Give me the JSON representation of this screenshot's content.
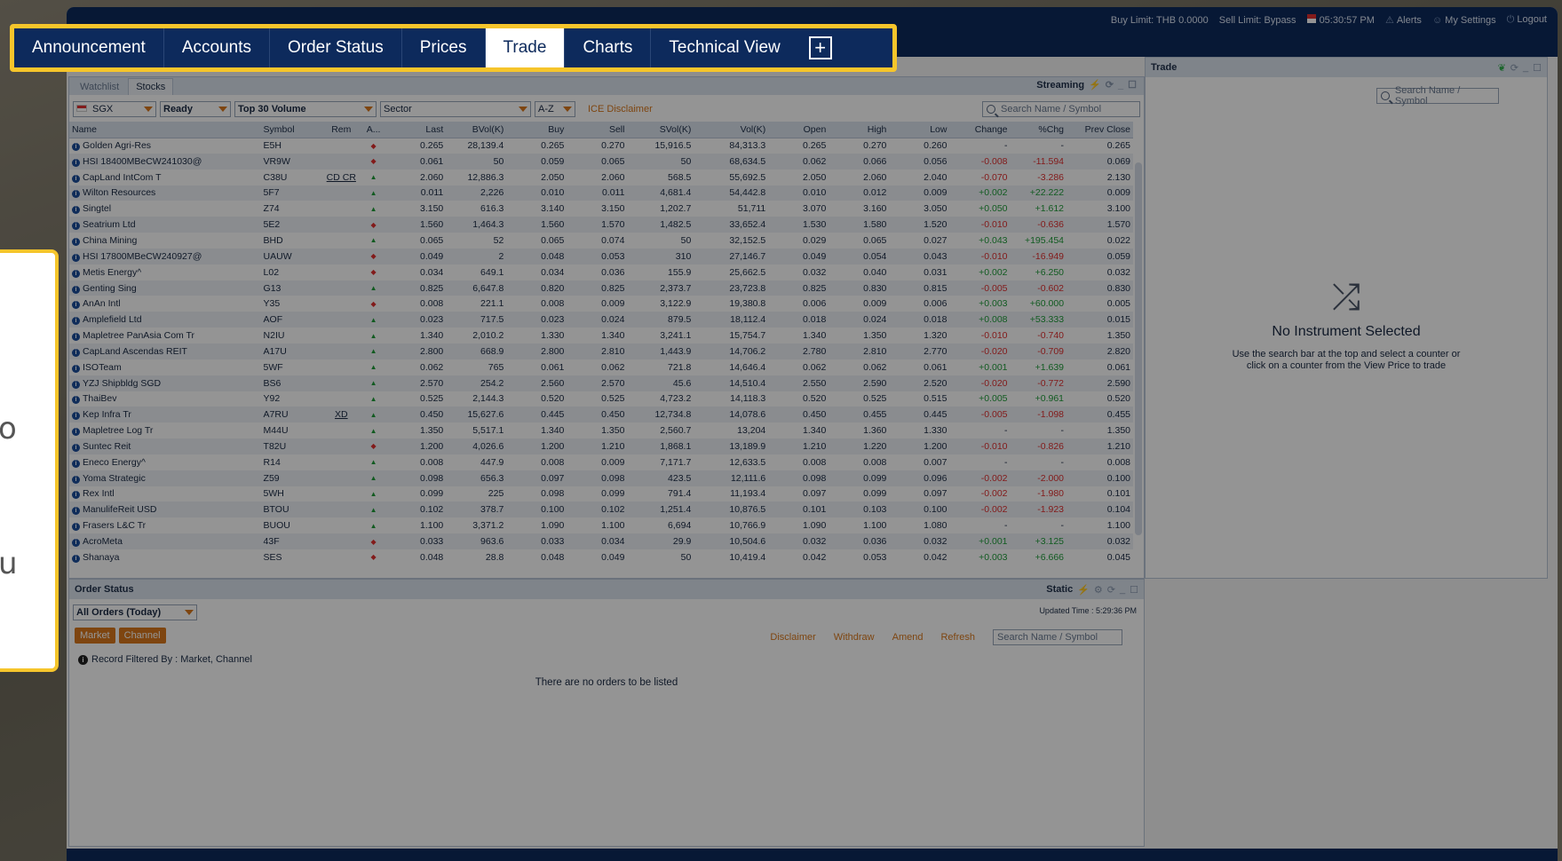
{
  "topbar": {
    "buy_limit": "Buy Limit: THB 0.0000",
    "sell_limit": "Sell Limit: Bypass",
    "time": "05:30:57 PM",
    "alerts": "Alerts",
    "settings": "My Settings",
    "logout": "Logout"
  },
  "nav": {
    "items": [
      "Announcement",
      "Accounts",
      "Order Status",
      "Prices",
      "Trade",
      "Charts",
      "Technical View"
    ],
    "active": "Trade"
  },
  "watchlist": {
    "tabs": [
      "Watchlist",
      "Stocks"
    ],
    "active_tab": "Stocks",
    "mode": "Streaming",
    "filters": {
      "market": "SGX",
      "status": "Ready",
      "list": "Top 30 Volume",
      "sector": "Sector",
      "sort": "A-Z",
      "disclaimer": "ICE Disclaimer",
      "search_placeholder": "Search Name / Symbol"
    },
    "columns": [
      "Name",
      "Symbol",
      "Rem",
      "A...",
      "Last",
      "BVol(K)",
      "Buy",
      "Sell",
      "SVol(K)",
      "Vol(K)",
      "Open",
      "High",
      "Low",
      "Change",
      "%Chg",
      "Prev Close"
    ],
    "rows": [
      {
        "name": "Golden Agri-Res",
        "symbol": "E5H",
        "rem": "",
        "dir": "dn",
        "last": "0.265",
        "bvol": "28,139.4",
        "buy": "0.265",
        "sell": "0.270",
        "svol": "15,916.5",
        "vol": "84,313.3",
        "open": "0.265",
        "high": "0.270",
        "low": "0.260",
        "chg": "-",
        "pchg": "-",
        "prev": "0.265"
      },
      {
        "name": "HSI 18400MBeCW241030@",
        "symbol": "VR9W",
        "rem": "",
        "dir": "dn",
        "last": "0.061",
        "bvol": "50",
        "buy": "0.059",
        "sell": "0.065",
        "svol": "50",
        "vol": "68,634.5",
        "open": "0.062",
        "high": "0.066",
        "low": "0.056",
        "chg": "-0.008",
        "pchg": "-11.594",
        "prev": "0.069"
      },
      {
        "name": "CapLand IntCom T",
        "symbol": "C38U",
        "rem": "CD CR",
        "dir": "up",
        "last": "2.060",
        "bvol": "12,886.3",
        "buy": "2.050",
        "sell": "2.060",
        "svol": "568.5",
        "vol": "55,692.5",
        "open": "2.050",
        "high": "2.060",
        "low": "2.040",
        "chg": "-0.070",
        "pchg": "-3.286",
        "prev": "2.130"
      },
      {
        "name": "Wilton Resources",
        "symbol": "5F7",
        "rem": "",
        "dir": "up",
        "last": "0.011",
        "bvol": "2,226",
        "buy": "0.010",
        "sell": "0.011",
        "svol": "4,681.4",
        "vol": "54,442.8",
        "open": "0.010",
        "high": "0.012",
        "low": "0.009",
        "chg": "+0.002",
        "pchg": "+22.222",
        "prev": "0.009"
      },
      {
        "name": "Singtel",
        "symbol": "Z74",
        "rem": "",
        "dir": "up",
        "last": "3.150",
        "bvol": "616.3",
        "buy": "3.140",
        "sell": "3.150",
        "svol": "1,202.7",
        "vol": "51,711",
        "open": "3.070",
        "high": "3.160",
        "low": "3.050",
        "chg": "+0.050",
        "pchg": "+1.612",
        "prev": "3.100"
      },
      {
        "name": "Seatrium Ltd",
        "symbol": "5E2",
        "rem": "",
        "dir": "dn",
        "last": "1.560",
        "bvol": "1,464.3",
        "buy": "1.560",
        "sell": "1.570",
        "svol": "1,482.5",
        "vol": "33,652.4",
        "open": "1.530",
        "high": "1.580",
        "low": "1.520",
        "chg": "-0.010",
        "pchg": "-0.636",
        "prev": "1.570"
      },
      {
        "name": "China Mining",
        "symbol": "BHD",
        "rem": "",
        "dir": "up",
        "last": "0.065",
        "bvol": "52",
        "buy": "0.065",
        "sell": "0.074",
        "svol": "50",
        "vol": "32,152.5",
        "open": "0.029",
        "high": "0.065",
        "low": "0.027",
        "chg": "+0.043",
        "pchg": "+195.454",
        "prev": "0.022"
      },
      {
        "name": "HSI 17800MBeCW240927@",
        "symbol": "UAUW",
        "rem": "",
        "dir": "dn",
        "last": "0.049",
        "bvol": "2",
        "buy": "0.048",
        "sell": "0.053",
        "svol": "310",
        "vol": "27,146.7",
        "open": "0.049",
        "high": "0.054",
        "low": "0.043",
        "chg": "-0.010",
        "pchg": "-16.949",
        "prev": "0.059"
      },
      {
        "name": "Metis Energy^",
        "symbol": "L02",
        "rem": "",
        "dir": "dn",
        "last": "0.034",
        "bvol": "649.1",
        "buy": "0.034",
        "sell": "0.036",
        "svol": "155.9",
        "vol": "25,662.5",
        "open": "0.032",
        "high": "0.040",
        "low": "0.031",
        "chg": "+0.002",
        "pchg": "+6.250",
        "prev": "0.032"
      },
      {
        "name": "Genting Sing",
        "symbol": "G13",
        "rem": "",
        "dir": "up",
        "last": "0.825",
        "bvol": "6,647.8",
        "buy": "0.820",
        "sell": "0.825",
        "svol": "2,373.7",
        "vol": "23,723.8",
        "open": "0.825",
        "high": "0.830",
        "low": "0.815",
        "chg": "-0.005",
        "pchg": "-0.602",
        "prev": "0.830"
      },
      {
        "name": "AnAn Intl",
        "symbol": "Y35",
        "rem": "",
        "dir": "dn",
        "last": "0.008",
        "bvol": "221.1",
        "buy": "0.008",
        "sell": "0.009",
        "svol": "3,122.9",
        "vol": "19,380.8",
        "open": "0.006",
        "high": "0.009",
        "low": "0.006",
        "chg": "+0.003",
        "pchg": "+60.000",
        "prev": "0.005"
      },
      {
        "name": "Amplefield Ltd",
        "symbol": "AOF",
        "rem": "",
        "dir": "up",
        "last": "0.023",
        "bvol": "717.5",
        "buy": "0.023",
        "sell": "0.024",
        "svol": "879.5",
        "vol": "18,112.4",
        "open": "0.018",
        "high": "0.024",
        "low": "0.018",
        "chg": "+0.008",
        "pchg": "+53.333",
        "prev": "0.015"
      },
      {
        "name": "Mapletree PanAsia Com Tr",
        "symbol": "N2IU",
        "rem": "",
        "dir": "up",
        "last": "1.340",
        "bvol": "2,010.2",
        "buy": "1.330",
        "sell": "1.340",
        "svol": "3,241.1",
        "vol": "15,754.7",
        "open": "1.340",
        "high": "1.350",
        "low": "1.320",
        "chg": "-0.010",
        "pchg": "-0.740",
        "prev": "1.350"
      },
      {
        "name": "CapLand Ascendas REIT",
        "symbol": "A17U",
        "rem": "",
        "dir": "up",
        "last": "2.800",
        "bvol": "668.9",
        "buy": "2.800",
        "sell": "2.810",
        "svol": "1,443.9",
        "vol": "14,706.2",
        "open": "2.780",
        "high": "2.810",
        "low": "2.770",
        "chg": "-0.020",
        "pchg": "-0.709",
        "prev": "2.820"
      },
      {
        "name": "ISOTeam",
        "symbol": "5WF",
        "rem": "",
        "dir": "up",
        "last": "0.062",
        "bvol": "765",
        "buy": "0.061",
        "sell": "0.062",
        "svol": "721.8",
        "vol": "14,646.4",
        "open": "0.062",
        "high": "0.062",
        "low": "0.061",
        "chg": "+0.001",
        "pchg": "+1.639",
        "prev": "0.061"
      },
      {
        "name": "YZJ Shipbldg SGD",
        "symbol": "BS6",
        "rem": "",
        "dir": "up",
        "last": "2.570",
        "bvol": "254.2",
        "buy": "2.560",
        "sell": "2.570",
        "svol": "45.6",
        "vol": "14,510.4",
        "open": "2.550",
        "high": "2.590",
        "low": "2.520",
        "chg": "-0.020",
        "pchg": "-0.772",
        "prev": "2.590"
      },
      {
        "name": "ThaiBev",
        "symbol": "Y92",
        "rem": "",
        "dir": "up",
        "last": "0.525",
        "bvol": "2,144.3",
        "buy": "0.520",
        "sell": "0.525",
        "svol": "4,723.2",
        "vol": "14,118.3",
        "open": "0.520",
        "high": "0.525",
        "low": "0.515",
        "chg": "+0.005",
        "pchg": "+0.961",
        "prev": "0.520"
      },
      {
        "name": "Kep Infra Tr",
        "symbol": "A7RU",
        "rem": "XD",
        "dir": "up",
        "last": "0.450",
        "bvol": "15,627.6",
        "buy": "0.445",
        "sell": "0.450",
        "svol": "12,734.8",
        "vol": "14,078.6",
        "open": "0.450",
        "high": "0.455",
        "low": "0.445",
        "chg": "-0.005",
        "pchg": "-1.098",
        "prev": "0.455"
      },
      {
        "name": "Mapletree Log Tr",
        "symbol": "M44U",
        "rem": "",
        "dir": "up",
        "last": "1.350",
        "bvol": "5,517.1",
        "buy": "1.340",
        "sell": "1.350",
        "svol": "2,560.7",
        "vol": "13,204",
        "open": "1.340",
        "high": "1.360",
        "low": "1.330",
        "chg": "-",
        "pchg": "-",
        "prev": "1.350"
      },
      {
        "name": "Suntec Reit",
        "symbol": "T82U",
        "rem": "",
        "dir": "dn",
        "last": "1.200",
        "bvol": "4,026.6",
        "buy": "1.200",
        "sell": "1.210",
        "svol": "1,868.1",
        "vol": "13,189.9",
        "open": "1.210",
        "high": "1.220",
        "low": "1.200",
        "chg": "-0.010",
        "pchg": "-0.826",
        "prev": "1.210"
      },
      {
        "name": "Eneco Energy^",
        "symbol": "R14",
        "rem": "",
        "dir": "up",
        "last": "0.008",
        "bvol": "447.9",
        "buy": "0.008",
        "sell": "0.009",
        "svol": "7,171.7",
        "vol": "12,633.5",
        "open": "0.008",
        "high": "0.008",
        "low": "0.007",
        "chg": "-",
        "pchg": "-",
        "prev": "0.008"
      },
      {
        "name": "Yoma Strategic",
        "symbol": "Z59",
        "rem": "",
        "dir": "up",
        "last": "0.098",
        "bvol": "656.3",
        "buy": "0.097",
        "sell": "0.098",
        "svol": "423.5",
        "vol": "12,111.6",
        "open": "0.098",
        "high": "0.099",
        "low": "0.096",
        "chg": "-0.002",
        "pchg": "-2.000",
        "prev": "0.100"
      },
      {
        "name": "Rex Intl",
        "symbol": "5WH",
        "rem": "",
        "dir": "up",
        "last": "0.099",
        "bvol": "225",
        "buy": "0.098",
        "sell": "0.099",
        "svol": "791.4",
        "vol": "11,193.4",
        "open": "0.097",
        "high": "0.099",
        "low": "0.097",
        "chg": "-0.002",
        "pchg": "-1.980",
        "prev": "0.101"
      },
      {
        "name": "ManulifeReit USD",
        "symbol": "BTOU",
        "rem": "",
        "dir": "up",
        "last": "0.102",
        "bvol": "378.7",
        "buy": "0.100",
        "sell": "0.102",
        "svol": "1,251.4",
        "vol": "10,876.5",
        "open": "0.101",
        "high": "0.103",
        "low": "0.100",
        "chg": "-0.002",
        "pchg": "-1.923",
        "prev": "0.104"
      },
      {
        "name": "Frasers L&C Tr",
        "symbol": "BUOU",
        "rem": "",
        "dir": "up",
        "last": "1.100",
        "bvol": "3,371.2",
        "buy": "1.090",
        "sell": "1.100",
        "svol": "6,694",
        "vol": "10,766.9",
        "open": "1.090",
        "high": "1.100",
        "low": "1.080",
        "chg": "-",
        "pchg": "-",
        "prev": "1.100"
      },
      {
        "name": "AcroMeta",
        "symbol": "43F",
        "rem": "",
        "dir": "dn",
        "last": "0.033",
        "bvol": "963.6",
        "buy": "0.033",
        "sell": "0.034",
        "svol": "29.9",
        "vol": "10,504.6",
        "open": "0.032",
        "high": "0.036",
        "low": "0.032",
        "chg": "+0.001",
        "pchg": "+3.125",
        "prev": "0.032"
      },
      {
        "name": "Shanaya",
        "symbol": "SES",
        "rem": "",
        "dir": "dn",
        "last": "0.048",
        "bvol": "28.8",
        "buy": "0.048",
        "sell": "0.049",
        "svol": "50",
        "vol": "10,419.4",
        "open": "0.042",
        "high": "0.053",
        "low": "0.042",
        "chg": "+0.003",
        "pchg": "+6.666",
        "prev": "0.045"
      }
    ]
  },
  "trade": {
    "title": "Trade",
    "search_placeholder": "Search Name / Symbol",
    "empty_title": "No Instrument Selected",
    "empty_line1": "Use the search bar at the top and select a counter or",
    "empty_line2": "click on a counter from the View Price to trade"
  },
  "orders": {
    "title": "Order Status",
    "mode": "Static",
    "filter": "All Orders (Today)",
    "chips": [
      "Market",
      "Channel"
    ],
    "updated": "Updated Time : 5:29:36 PM",
    "links": [
      "Disclaimer",
      "Withdraw",
      "Amend",
      "Refresh"
    ],
    "search_placeholder": "Search Name / Symbol",
    "filtered_by": "Record Filtered By : Market, Channel",
    "empty": "There are no orders to be listed"
  },
  "callout": {
    "char1": "o",
    "char2": "u"
  },
  "colors": {
    "navy": "#0d2a5c",
    "highlight": "#f6c52b",
    "accent_orange": "#d9781c",
    "up_green": "#1f9d3a",
    "down_red": "#e03030"
  }
}
